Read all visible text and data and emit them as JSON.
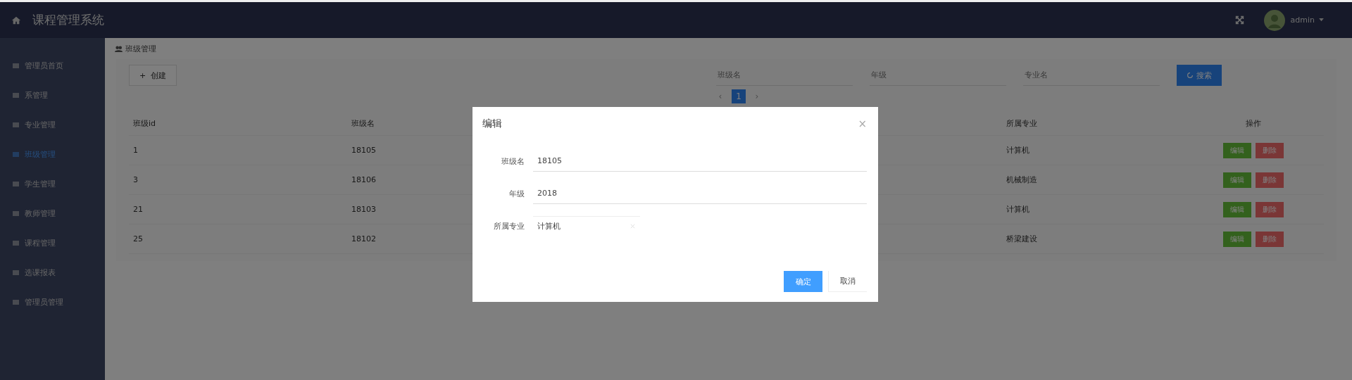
{
  "header": {
    "title": "课程管理系统",
    "user": "admin"
  },
  "sidebar": {
    "items": [
      {
        "label": "管理员首页",
        "selected": false
      },
      {
        "label": "系管理",
        "selected": false
      },
      {
        "label": "专业管理",
        "selected": false
      },
      {
        "label": "班级管理",
        "selected": true
      },
      {
        "label": "学生管理",
        "selected": false
      },
      {
        "label": "教师管理",
        "selected": false
      },
      {
        "label": "课程管理",
        "selected": false
      },
      {
        "label": "选课报表",
        "selected": false
      },
      {
        "label": "管理员管理",
        "selected": false
      }
    ]
  },
  "breadcrumb": "班级管理",
  "toolbar": {
    "create_button": "创建",
    "create_icon": "+",
    "search_fields": [
      {
        "placeholder": "班级名"
      },
      {
        "placeholder": "年级"
      },
      {
        "placeholder": "专业名"
      }
    ],
    "search_button": "搜索"
  },
  "pagination": {
    "prev": "‹",
    "pages": [
      {
        "label": "1",
        "selected": true
      }
    ],
    "next": "›"
  },
  "table": {
    "columns": [
      "班级id",
      "班级名",
      "所属专业",
      "操作"
    ],
    "rows": [
      {
        "cells": [
          "1",
          "18105",
          "计算机"
        ],
        "actions": [
          "编辑",
          "删除"
        ]
      },
      {
        "cells": [
          "3",
          "18106",
          "机械制造"
        ],
        "actions": [
          "编辑",
          "删除"
        ]
      },
      {
        "cells": [
          "21",
          "18103",
          "计算机"
        ],
        "actions": [
          "编辑",
          "删除"
        ]
      },
      {
        "cells": [
          "25",
          "18102",
          "桥梁建设"
        ],
        "actions": [
          "编辑",
          "删除"
        ]
      }
    ]
  },
  "dialog": {
    "title": "编辑",
    "close": "×",
    "fields": [
      {
        "kind": "text",
        "label": "班级名",
        "value": "18105"
      },
      {
        "kind": "text",
        "label": "年级",
        "value": "2018"
      },
      {
        "kind": "select",
        "label": "所属专业",
        "value": "计算机"
      }
    ],
    "buttons": [
      {
        "label": "确定",
        "kind": "primary"
      },
      {
        "label": "取消",
        "kind": "plain"
      }
    ]
  }
}
